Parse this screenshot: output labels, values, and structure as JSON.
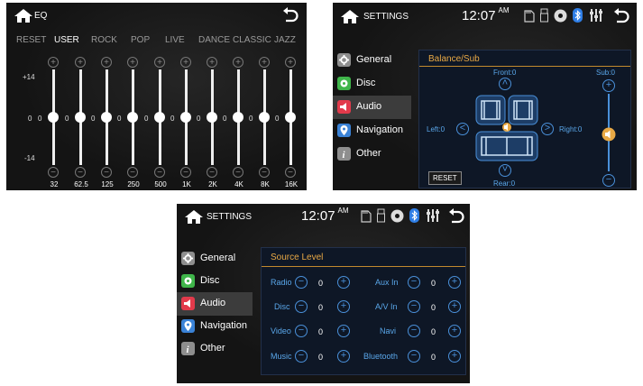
{
  "eq": {
    "title": "EQ",
    "presets": [
      "RESET",
      "USER",
      "ROCK",
      "POP",
      "LIVE",
      "DANCE",
      "CLASSIC",
      "JAZZ"
    ],
    "active_preset": "USER",
    "scale_top": "+14",
    "scale_mid": "0",
    "scale_bottom": "-14",
    "plus_symbol": "+",
    "minus_symbol": "−",
    "bands": [
      {
        "freq": "32",
        "value": "0"
      },
      {
        "freq": "62.5",
        "value": "0"
      },
      {
        "freq": "125",
        "value": "0"
      },
      {
        "freq": "250",
        "value": "0"
      },
      {
        "freq": "500",
        "value": "0"
      },
      {
        "freq": "1K",
        "value": "0"
      },
      {
        "freq": "2K",
        "value": "0"
      },
      {
        "freq": "4K",
        "value": "0"
      },
      {
        "freq": "8K",
        "value": "0"
      },
      {
        "freq": "16K",
        "value": "0"
      }
    ]
  },
  "settings": {
    "title": "SETTINGS",
    "time": "12:07",
    "ampm": "AM",
    "menu": [
      {
        "label": "General",
        "icon": "gear-icon",
        "color": "#8e8e8e"
      },
      {
        "label": "Disc",
        "icon": "disc-icon",
        "color": "#3fb54a"
      },
      {
        "label": "Audio",
        "icon": "speaker-icon",
        "color": "#e23a4b"
      },
      {
        "label": "Navigation",
        "icon": "map-pin-icon",
        "color": "#3a82d6"
      },
      {
        "label": "Other",
        "icon": "info-icon",
        "color": "#8e8e8e"
      }
    ],
    "active_menu": "Audio"
  },
  "balance": {
    "heading": "Balance/Sub",
    "front": "Front:0",
    "rear": "Rear:0",
    "left": "Left:0",
    "right": "Right:0",
    "sub": "Sub:0",
    "reset": "RESET"
  },
  "source_level": {
    "heading": "Source Level",
    "left_items": [
      {
        "label": "Radio",
        "value": "0"
      },
      {
        "label": "Disc",
        "value": "0"
      },
      {
        "label": "Video",
        "value": "0"
      },
      {
        "label": "Music",
        "value": "0"
      }
    ],
    "right_items": [
      {
        "label": "Aux In",
        "value": "0"
      },
      {
        "label": "A/V In",
        "value": "0"
      },
      {
        "label": "Navi",
        "value": "0"
      },
      {
        "label": "Bluetooth",
        "value": "0"
      }
    ]
  },
  "colors": {
    "accent_blue": "#4a90d9",
    "heading_orange": "#e9a945",
    "bluetooth_blue": "#2f7ee6"
  }
}
